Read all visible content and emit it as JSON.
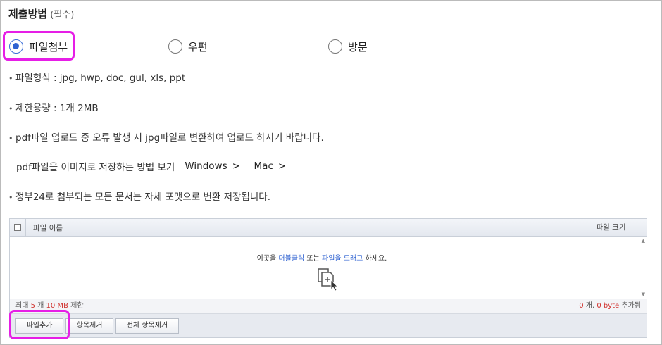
{
  "section": {
    "title": "제출방법",
    "required": "(필수)"
  },
  "methods": [
    {
      "label": "파일첨부",
      "checked": true
    },
    {
      "label": "우편",
      "checked": false
    },
    {
      "label": "방문",
      "checked": false
    }
  ],
  "notes": {
    "file_format": "파일형식 : jpg, hwp, doc, gul, xls, ppt",
    "size_limit": "제한용량 : 1개 2MB",
    "pdf_error": "pdf파일 업로드 중 오류 발생 시 jpg파일로 변환하여 업로드 하시기 바랍니다.",
    "save_guide": "pdf파일을 이미지로 저장하는 방법 보기",
    "windows_link": "Windows",
    "mac_link": "Mac",
    "convert_note": "정부24로 첨부되는 모든 문서는 자체 포맷으로 변환 저장됩니다."
  },
  "uploader": {
    "col_name": "파일 이름",
    "col_size": "파일 크기",
    "drop_pre": "이곳을 ",
    "drop_dbl": "더블클릭",
    "drop_mid": " 또는 ",
    "drop_drag": "파일을 드래그",
    "drop_post": " 하세요.",
    "limit_pre": "최대 ",
    "limit_count": "5",
    "limit_mid": " 개  ",
    "limit_size": "10 MB",
    "limit_post": " 제한",
    "added_count": "0",
    "added_mid": " 개, ",
    "added_size": "0 byte",
    "added_post": " 추가됨"
  },
  "buttons": {
    "add_file": "파일추가",
    "remove_item": "항목제거",
    "remove_all": "전체 항목제거"
  },
  "colors": {
    "accent": "#2f62d1",
    "highlight": "#e61ee6",
    "warning": "#d0312d"
  }
}
